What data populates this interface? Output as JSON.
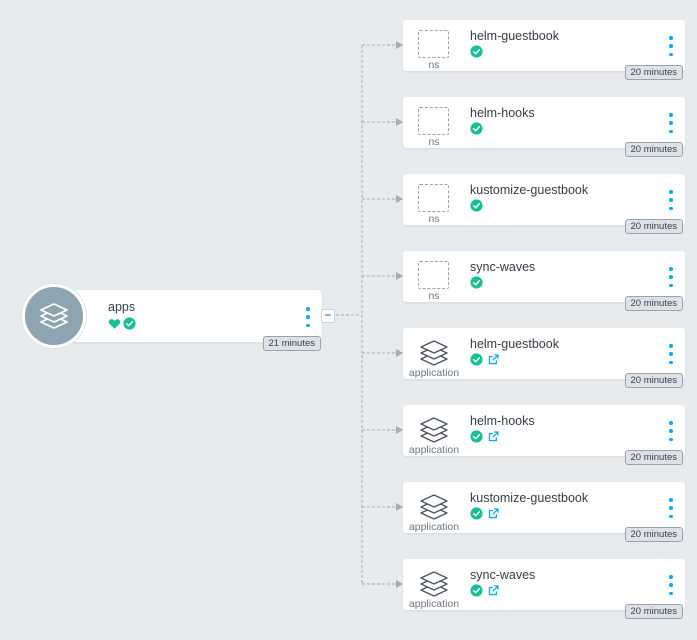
{
  "colors": {
    "background": "#e7ebee",
    "healthy": "#18be94",
    "accent": "#0dadea",
    "edge": "#a3acb5"
  },
  "root": {
    "name": "apps",
    "age": "21 minutes",
    "icon": "layers-icon",
    "health_icon": "heart-icon",
    "sync_icon": "check-circle-icon",
    "collapse_label": "−"
  },
  "nodes": [
    {
      "name": "helm-guestbook",
      "kind": "ns",
      "age": "20 minutes"
    },
    {
      "name": "helm-hooks",
      "kind": "ns",
      "age": "20 minutes"
    },
    {
      "name": "kustomize-guestbook",
      "kind": "ns",
      "age": "20 minutes"
    },
    {
      "name": "sync-waves",
      "kind": "ns",
      "age": "20 minutes"
    },
    {
      "name": "helm-guestbook",
      "kind": "application",
      "age": "20 minutes"
    },
    {
      "name": "helm-hooks",
      "kind": "application",
      "age": "20 minutes"
    },
    {
      "name": "kustomize-guestbook",
      "kind": "application",
      "age": "20 minutes"
    },
    {
      "name": "sync-waves",
      "kind": "application",
      "age": "20 minutes"
    }
  ]
}
